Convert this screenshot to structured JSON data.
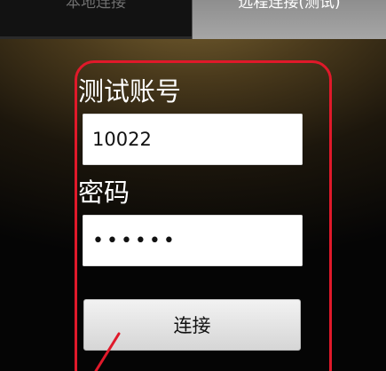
{
  "tabs": {
    "local_label": "本地连接",
    "remote_label": "远程连接(测试)"
  },
  "form": {
    "account_label": "测试账号",
    "account_value": "10022",
    "password_label": "密码",
    "password_value": "••••••",
    "connect_label": "连接"
  },
  "colors": {
    "highlight": "#e0192a"
  }
}
